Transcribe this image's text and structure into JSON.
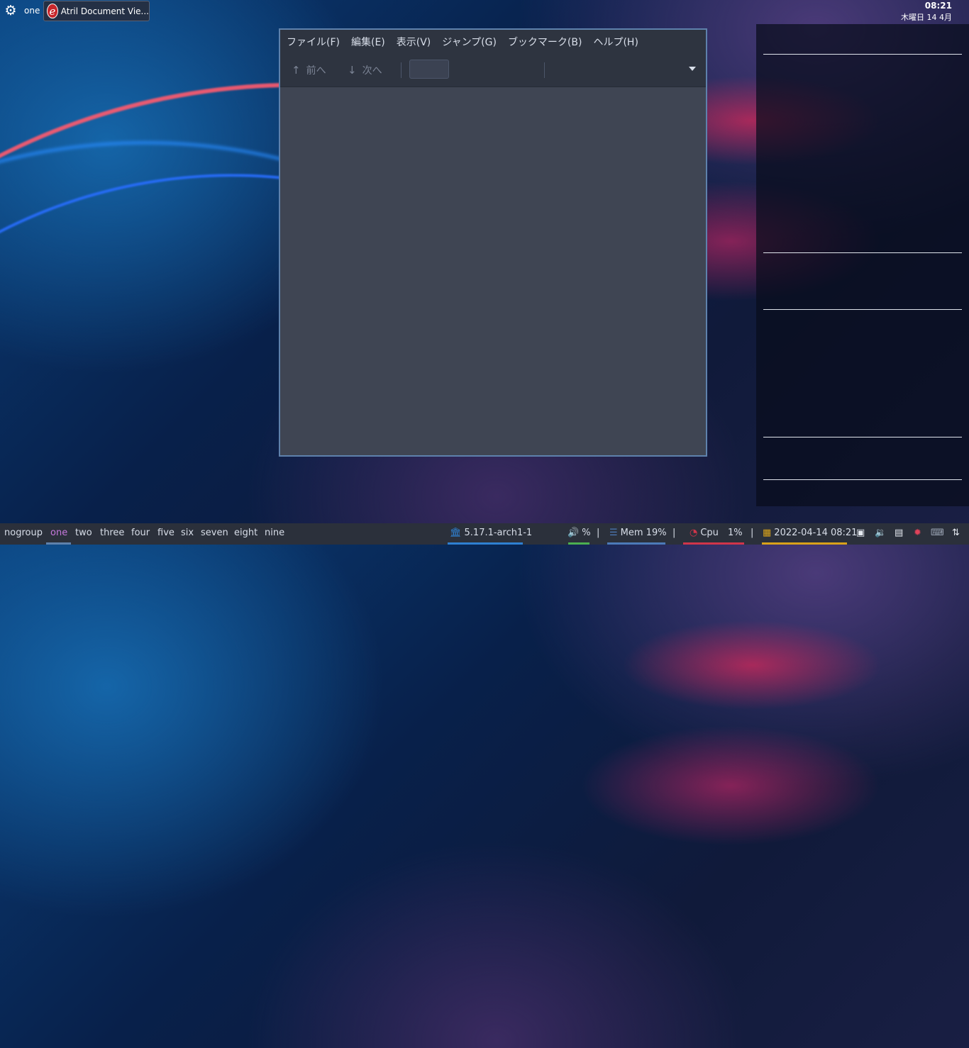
{
  "topbar": {
    "workspace": "one",
    "task_title": "Atril Document Vie...",
    "clock_time": "08:21",
    "clock_date": "木曜日 14 4月"
  },
  "window": {
    "menus": [
      "ファイル(F)",
      "編集(E)",
      "表示(V)",
      "ジャンプ(G)",
      "ブックマーク(B)",
      "ヘルプ(H)"
    ],
    "prev_label": "前へ",
    "next_label": "次へ",
    "page_value": ""
  },
  "bottombar": {
    "workspaces": [
      "nogroup",
      "one",
      "two",
      "three",
      "four",
      "five",
      "six",
      "seven",
      "eight",
      "nine"
    ],
    "active_workspace": "one",
    "kernel": "5.17.1-arch1-1",
    "volume": "%",
    "mem": "Mem 19%",
    "cpu_label": "Cpu",
    "cpu_value": "1%",
    "datetime": "2022-04-14 08:21",
    "separator": "|"
  },
  "colors": {
    "accent": "#5e81ac",
    "active_ws": "#c678dd",
    "kernel_underline": "#2f80d1",
    "vol_underline": "#4caf50",
    "mem_underline": "#4c7ab8",
    "cpu_underline": "#d0354a",
    "date_underline": "#d8a21a"
  }
}
